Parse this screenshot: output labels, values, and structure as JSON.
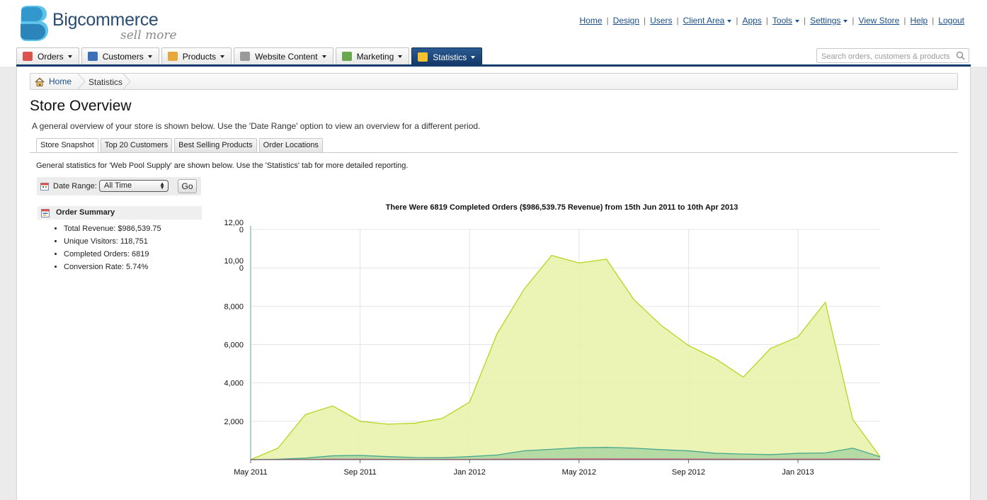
{
  "header": {
    "logo_text": "Bigcommerce",
    "logo_tagline": "sell more",
    "links": [
      {
        "label": "Home",
        "dropdown": false
      },
      {
        "label": "Design",
        "dropdown": false
      },
      {
        "label": "Users",
        "dropdown": false
      },
      {
        "label": "Client Area",
        "dropdown": true
      },
      {
        "label": "Apps",
        "dropdown": false
      },
      {
        "label": "Tools",
        "dropdown": true
      },
      {
        "label": "Settings",
        "dropdown": true
      },
      {
        "label": "View Store",
        "dropdown": false
      },
      {
        "label": "Help",
        "dropdown": false
      },
      {
        "label": "Logout",
        "dropdown": false
      }
    ]
  },
  "nav": {
    "tabs": [
      {
        "label": "Orders",
        "icon": "orders-icon",
        "color": "#d9534f"
      },
      {
        "label": "Customers",
        "icon": "customers-icon",
        "color": "#3b6fb6"
      },
      {
        "label": "Products",
        "icon": "products-icon",
        "color": "#e6a83a"
      },
      {
        "label": "Website Content",
        "icon": "website-content-icon",
        "color": "#9a9a9a"
      },
      {
        "label": "Marketing",
        "icon": "marketing-icon",
        "color": "#6aa84f"
      },
      {
        "label": "Statistics",
        "icon": "statistics-icon",
        "color": "#f2c230",
        "active": true
      }
    ],
    "search_placeholder": "Search orders, customers & products"
  },
  "breadcrumb": {
    "home": "Home",
    "current": "Statistics"
  },
  "page": {
    "title": "Store Overview",
    "intro": "A general overview of your store is shown below. Use the 'Date Range' option to view an overview for a different period.",
    "subtabs": [
      "Store Snapshot",
      "Top 20 Customers",
      "Best Selling Products",
      "Order Locations"
    ],
    "active_subtab": "Store Snapshot",
    "stats_note": "General statistics for 'Web Pool Supply' are shown below. Use the 'Statistics' tab for more detailed reporting."
  },
  "date_range": {
    "label": "Date Range:",
    "selected": "All Time",
    "go_label": "Go"
  },
  "order_summary": {
    "title": "Order Summary",
    "items": [
      "Total Revenue: $986,539.75",
      "Unique Visitors: 118,751",
      "Completed Orders: 6819",
      "Conversion Rate: 5.74%"
    ]
  },
  "chart_data": {
    "type": "area",
    "title": "There Were 6819 Completed Orders ($986,539.75 Revenue) from 15th Jun 2011 to 10th Apr 2013",
    "x": [
      "2011-05",
      "2011-06",
      "2011-07",
      "2011-08",
      "2011-09",
      "2011-10",
      "2011-11",
      "2011-12",
      "2012-01",
      "2012-02",
      "2012-03",
      "2012-04",
      "2012-05",
      "2012-06",
      "2012-07",
      "2012-08",
      "2012-09",
      "2012-10",
      "2012-11",
      "2012-12",
      "2013-01",
      "2013-02",
      "2013-03",
      "2013-04"
    ],
    "x_tick_labels": [
      "May 2011",
      "Sep 2011",
      "Jan 2012",
      "May 2012",
      "Sep 2012",
      "Jan 2013"
    ],
    "y_tick_labels": [
      "2,000",
      "4,000",
      "6,000",
      "8,000",
      "10,00\n0",
      "12,00\n0"
    ],
    "ylim": [
      0,
      12000
    ],
    "grid": true,
    "series": [
      {
        "color": "#b5d51f",
        "fill": "#e8f2a8",
        "values": [
          0,
          600,
          2350,
          2800,
          2000,
          1850,
          1900,
          2150,
          3000,
          6550,
          8900,
          10650,
          10250,
          10450,
          8350,
          7000,
          5950,
          5250,
          4300,
          5800,
          6400,
          8200,
          2100,
          150
        ]
      },
      {
        "color": "#4aa88e",
        "fill": "#a9d6a0",
        "values": [
          0,
          20,
          80,
          200,
          220,
          160,
          110,
          100,
          160,
          240,
          460,
          540,
          620,
          640,
          600,
          520,
          460,
          330,
          290,
          260,
          330,
          350,
          600,
          150
        ]
      },
      {
        "color": "#e05a8a",
        "fill": "none",
        "values": [
          0,
          5,
          10,
          20,
          20,
          15,
          10,
          10,
          15,
          20,
          30,
          35,
          40,
          40,
          38,
          34,
          30,
          25,
          22,
          20,
          25,
          26,
          35,
          10
        ]
      }
    ]
  }
}
